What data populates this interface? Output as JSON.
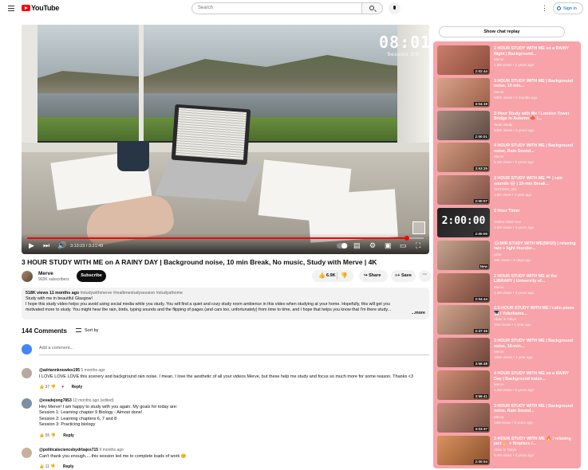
{
  "header": {
    "logo_text": "YouTube",
    "search_placeholder": "Search",
    "more_icon": "⋮",
    "signin_label": "Sign in"
  },
  "player": {
    "timer": "08:01",
    "session": "Session 3/3",
    "current_time": "3:13:23 / 3:21:49",
    "progress": 0.958,
    "icons": [
      "play-icon",
      "next-icon",
      "volume-icon",
      "autoplay-toggle",
      "settings-icon",
      "miniplayer-icon",
      "theater-icon",
      "cast-icon",
      "fullscreen-icon"
    ]
  },
  "video": {
    "title": "3 HOUR STUDY WITH ME on A RAINY DAY | Background noise, 10 min Break, No music, Study with Merve | 4K",
    "channel": "Merve",
    "subscribers": "903K subscribers",
    "subscribe_label": "Subscribe",
    "likes": "6.9K",
    "share_label": "Share",
    "save_label": "Save"
  },
  "description": {
    "stats": "518K views  11 months ago",
    "tags": "#studywithmerve #realtimestudysession #studyathome",
    "line1": "Study with me in beautiful Glasgow!",
    "line2": "I hope this study video helps you avoid using social media while you study. You will find a quiet and cozy study room ambience in this video when studying at your home. Hopefully, this will get you",
    "line3": "motivated more to study. You might hear the rain, birds, typing sounds and the flipping of pages (and cars too, unfortunately) from time to time, and I hope that helps you know that I'm there study...",
    "more": "...more"
  },
  "comments": {
    "count": "144 Comments",
    "sort_label": "Sort by",
    "add_placeholder": "Add a comment...",
    "reply_label": "Reply",
    "items": [
      {
        "handle": "@adriannknowles195",
        "ago": "5 months ago",
        "lines": [
          "I LOVE LOVE LOVE this scenery and background rain noise. I mean, I love the aesthetic of all your videos Merve, but these help me study and focus so much more for some reason. Thanks <3"
        ],
        "likes": "37",
        "hearted": true
      },
      {
        "handle": "@evadejong7853",
        "ago": "10 months ago (edited)",
        "lines": [
          "Hey Merve! I am happy to study with you again. My goals for today are:",
          "Session 1: Learning chapter 9 Biology - Almost done!",
          "Session 2: Learning chapters 6, 7 and 8",
          "Session 3: Practicing biology"
        ],
        "likes": "55",
        "hearted": false
      },
      {
        "handle": "@politicalsciencebydrbajes715",
        "ago": "9 months ago",
        "lines": [
          "Can't thank you enough.....this session led me to complete loads of work 😊"
        ],
        "likes": "11",
        "hearted": false
      }
    ]
  },
  "sidebar": {
    "chat_replay_label": "Show chat replay",
    "highlight_color": "#f7a3a9",
    "items": [
      {
        "title": "2 HOUR STUDY WITH ME on a RAINY Night | Background...",
        "channel": "Merve",
        "stats": "1.3M views  •  2 years ago",
        "duration": "2:02:44"
      },
      {
        "title": "3 HOUR STUDY WITH ME | Background noise, 10 min...",
        "channel": "Merve",
        "stats": "508K views  •  2 months ago",
        "duration": "3:04:19"
      },
      {
        "title": "2-Hour Study with Me / London Tower Bridge in Autumn 🍁 /...",
        "channel": "Sean Study",
        "stats": "545K views  •  2 years ago",
        "duration": "2:00:01"
      },
      {
        "title": "4 HOUR STUDY WITH ME | Background noise, Rain Sound...",
        "channel": "Merve",
        "stats": "5.1M views  •  2 years ago",
        "duration": "3:53:25"
      },
      {
        "title": "2 HOUR STUDY WITH ME 📖 | rain sounds 🌧 | 10-min Break...",
        "channel": "SUGGEN_ND",
        "stats": "1.9K views  •  1 year ago",
        "duration": "2:00:07"
      },
      {
        "title": "2 Hour Timer",
        "channel": "Online Alarm Kur",
        "stats": "3.6M views  •  4 years ago",
        "duration": "2:00:00",
        "timer_art": "2:00:00"
      },
      {
        "title": "🌧3HR STUDY WITH ME(50/10) | relaxing rain + light thunder...",
        "channel": "jcthe",
        "stats": "46K views  •  9 days ago",
        "duration": "New"
      },
      {
        "title": "2 HOUR STUDY WITH ME at the LIBRARY | University of...",
        "channel": "Merve",
        "stats": "1.2M views  •  3 years ago",
        "duration": "2:04:44"
      },
      {
        "title": "2.5-HOUR STUDY WITH ME / calm piano 🎹 / Yokohama...",
        "channel": "Abao in Tokyo",
        "stats": "10M views  •  1 year ago",
        "duration": "2:37:15"
      },
      {
        "title": "3 HOUR STUDY WITH ME | Background noise, 10-min...",
        "channel": "Merve",
        "stats": "186K views  •  1 year ago",
        "duration": "3:56:48"
      },
      {
        "title": "4 HOUR STUDY WITH ME on a RAINY Day | Background noise...",
        "channel": "Merve",
        "stats": "1.3M views  •  2 years ago",
        "duration": "3:56:41"
      },
      {
        "title": "3 HOUR STUDY WITH ME | Background noise, Rain Sound...",
        "channel": "Merve",
        "stats": "13M views  •  3 years ago",
        "duration": "3:03:37"
      },
      {
        "title": "2-HOUR STUDY WITH ME 🔥 / relaxing jazz 🎷 + fireplace /...",
        "channel": "Abao in Tokyo",
        "stats": "8.4M views  •  2 years ago",
        "duration": "2:00:04"
      }
    ]
  }
}
